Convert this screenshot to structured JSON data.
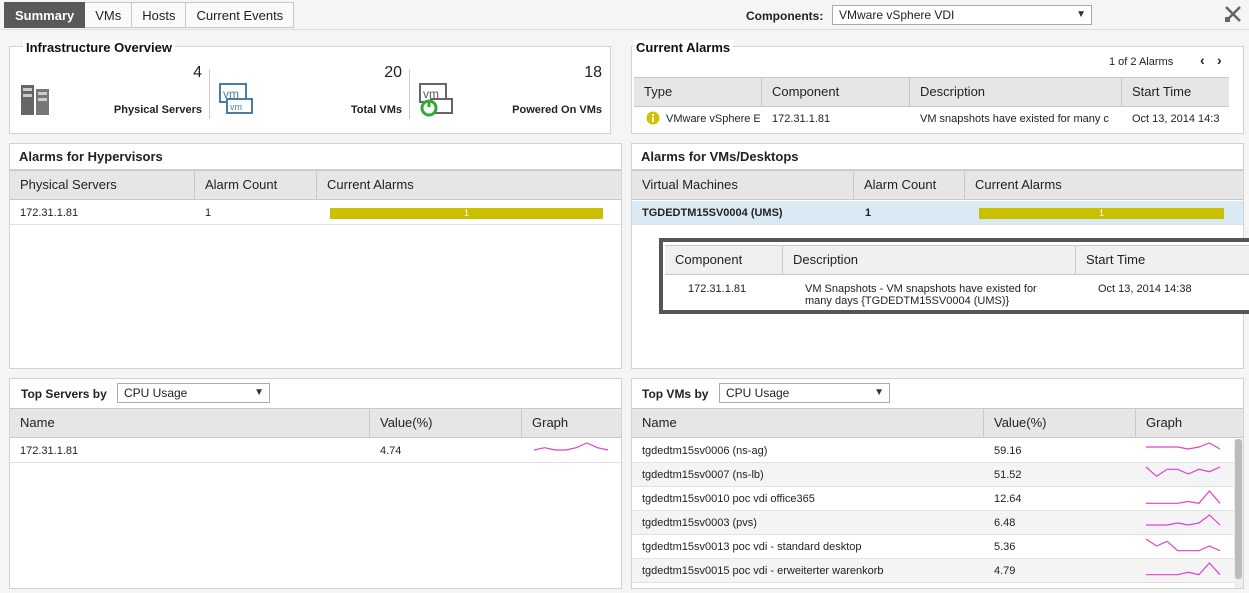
{
  "tabs": [
    {
      "label": "Summary",
      "active": true
    },
    {
      "label": "VMs",
      "active": false
    },
    {
      "label": "Hosts",
      "active": false
    },
    {
      "label": "Current Events",
      "active": false
    }
  ],
  "components": {
    "label": "Components:",
    "selected": "VMware vSphere VDI"
  },
  "infra": {
    "title": "Infrastructure Overview",
    "physical_servers": {
      "value": "4",
      "label": "Physical Servers",
      "icon": "server-icon"
    },
    "total_vms": {
      "value": "20",
      "label": "Total VMs",
      "icon": "vm-icon"
    },
    "powered_on_vms": {
      "value": "18",
      "label": "Powered On VMs",
      "icon": "vm-power-icon"
    }
  },
  "current_alarms": {
    "title": "Current Alarms",
    "pager": "1 of 2 Alarms",
    "columns": [
      "Type",
      "Component",
      "Description",
      "Start Time"
    ],
    "rows": [
      {
        "type": "VMware vSphere E",
        "component": "172.31.1.81",
        "description": "VM snapshots have existed for many c",
        "start": "Oct 13, 2014 14:3"
      }
    ]
  },
  "hyper_alarms": {
    "title": "Alarms for Hypervisors",
    "columns": [
      "Physical Servers",
      "Alarm Count",
      "Current Alarms"
    ],
    "rows": [
      {
        "name": "172.31.1.81",
        "count": "1",
        "bar": "1",
        "bar_fraction": 1.0
      }
    ]
  },
  "vm_alarms": {
    "title": "Alarms for VMs/Desktops",
    "columns": [
      "Virtual Machines",
      "Alarm Count",
      "Current Alarms"
    ],
    "rows": [
      {
        "name": "TGDEDTM15SV0004 (UMS)",
        "count": "1",
        "bar": "1",
        "bar_fraction": 1.0
      }
    ],
    "detail": {
      "columns": [
        "Component",
        "Description",
        "Start Time"
      ],
      "component": "172.31.1.81",
      "description_line1": "VM Snapshots - VM snapshots have existed for",
      "description_line2": "many days {TGDEDTM15SV0004 (UMS)}",
      "start": "Oct 13, 2014 14:38"
    }
  },
  "top_servers": {
    "label": "Top Servers by",
    "metric": "CPU Usage",
    "columns": [
      "Name",
      "Value(%)",
      "Graph"
    ],
    "rows": [
      {
        "name": "172.31.1.81",
        "value": "4.74",
        "spark": [
          3,
          4,
          3,
          3,
          4,
          6,
          4,
          3
        ]
      }
    ]
  },
  "top_vms": {
    "label": "Top VMs by",
    "metric": "CPU Usage",
    "columns": [
      "Name",
      "Value(%)",
      "Graph"
    ],
    "rows": [
      {
        "name": "tgdedtm15sv0006 (ns-ag)",
        "value": "59.16",
        "spark": [
          5,
          5,
          5,
          5,
          4,
          5,
          7,
          4
        ]
      },
      {
        "name": "tgdedtm15sv0007 (ns-lb)",
        "value": "51.52",
        "spark": [
          6,
          2,
          5,
          5,
          3,
          5,
          4,
          6
        ]
      },
      {
        "name": "tgdedtm15sv0010 poc vdi office365",
        "value": "12.64",
        "spark": [
          1,
          1,
          1,
          1,
          2,
          1,
          8,
          1
        ]
      },
      {
        "name": "tgdedtm15sv0003 (pvs)",
        "value": "6.48",
        "spark": [
          2,
          2,
          2,
          3,
          2,
          3,
          7,
          2
        ]
      },
      {
        "name": "tgdedtm15sv0013 poc vdi - standard desktop",
        "value": "5.36",
        "spark": [
          6,
          3,
          5,
          1,
          1,
          1,
          3,
          1
        ]
      },
      {
        "name": "tgdedtm15sv0015 poc vdi - erweiterter warenkorb",
        "value": "4.79",
        "spark": [
          1,
          1,
          1,
          1,
          2,
          1,
          6,
          1
        ]
      }
    ]
  },
  "colors": {
    "accent_tab": "#595959",
    "alarm_bar": "#c8c000",
    "spark": "#e040d0",
    "highlight_row": "#dbe9f5"
  }
}
